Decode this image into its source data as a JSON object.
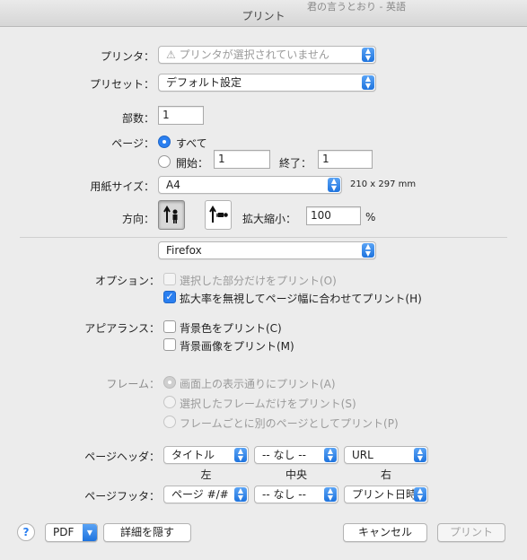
{
  "window": {
    "title": "プリント",
    "bg_text": "君の言うとおり - 英語"
  },
  "printer": {
    "label": "プリンタ：",
    "value": "プリンタが選択されていません"
  },
  "preset": {
    "label": "プリセット：",
    "value": "デフォルト設定"
  },
  "copies": {
    "label": "部数：",
    "value": "1"
  },
  "pages": {
    "label": "ページ：",
    "all_label": "すべて",
    "from_label": "開始：",
    "from_value": "1",
    "to_label": "終了：",
    "to_value": "1"
  },
  "paper": {
    "label": "用紙サイズ：",
    "value": "A4",
    "dimensions": "210 x 297 mm"
  },
  "orientation": {
    "label": "方向：",
    "scale_label": "拡大縮小：",
    "scale_value": "100",
    "percent": "%"
  },
  "app_menu": {
    "value": "Firefox"
  },
  "options": {
    "label": "オプション：",
    "print_selection": "選択した部分だけをプリント(O)",
    "ignore_scale": "拡大率を無視してページ幅に合わせてプリント(H)"
  },
  "appearance": {
    "label": "アピアランス：",
    "bg_colors": "背景色をプリント(C)",
    "bg_images": "背景画像をプリント(M)"
  },
  "frames": {
    "label": "フレーム：",
    "as_shown": "画面上の表示通りにプリント(A)",
    "selected_only": "選択したフレームだけをプリント(S)",
    "each_separate": "フレームごとに別のページとしてプリント(P)"
  },
  "header": {
    "label": "ページヘッダ：",
    "left": "タイトル",
    "center": "-- なし --",
    "right": "URL"
  },
  "columns": {
    "left": "左",
    "center": "中央",
    "right": "右"
  },
  "footer": {
    "label": "ページフッタ：",
    "left": "ページ #/#",
    "center": "-- なし --",
    "right": "プリント日時"
  },
  "bottom": {
    "help": "?",
    "pdf": "PDF",
    "hide_details": "詳細を隠す",
    "cancel": "キャンセル",
    "print": "プリント"
  },
  "colors": {
    "accent": "#2a7ff0",
    "window_bg": "#ececec"
  }
}
